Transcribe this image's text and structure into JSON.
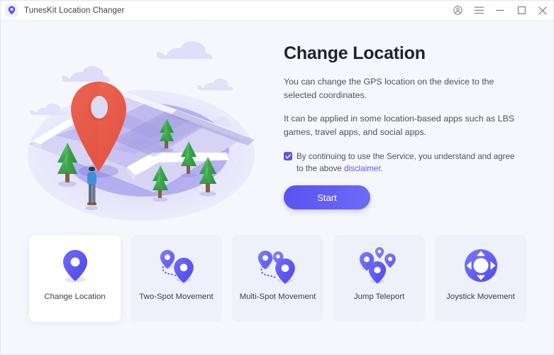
{
  "window": {
    "title": "TunesKit Location Changer",
    "app_icon": "location-pin-icon",
    "controls": {
      "account": "account-icon",
      "menu": "hamburger-menu-icon",
      "minimize": "minimize-icon",
      "maximize": "maximize-icon",
      "close": "close-icon"
    }
  },
  "hero": {
    "illustration_name": "isometric-map-with-location-pin-illustration",
    "title": "Change Location",
    "paragraph1": "You can change the GPS location on the device to the selected coordinates.",
    "paragraph2": "It can be applied in some location-based apps such as LBS games, travel apps, and social apps.",
    "agreement": {
      "checked": true,
      "text_before": "By continuing to use the Service, you understand and agree to the above ",
      "link_label": "disclaimer",
      "text_after": "."
    },
    "start_label": "Start"
  },
  "modes": {
    "cards": [
      {
        "label": "Change Location",
        "icon": "single-pin-icon",
        "selected": true
      },
      {
        "label": "Two-Spot Movement",
        "icon": "two-pins-dotted-path-icon",
        "selected": false
      },
      {
        "label": "Multi-Spot Movement",
        "icon": "three-pins-dotted-path-icon",
        "selected": false
      },
      {
        "label": "Jump Teleport",
        "icon": "four-scattered-pins-icon",
        "selected": false
      },
      {
        "label": "Joystick Movement",
        "icon": "joystick-dpad-icon",
        "selected": false
      }
    ]
  },
  "colors": {
    "accent": "#5B55F0",
    "accent_light": "#6D6BF6",
    "pin_red": "#EC5E4F",
    "page_bg": "#F6F7FD",
    "card_bg": "#EEF0FA"
  }
}
